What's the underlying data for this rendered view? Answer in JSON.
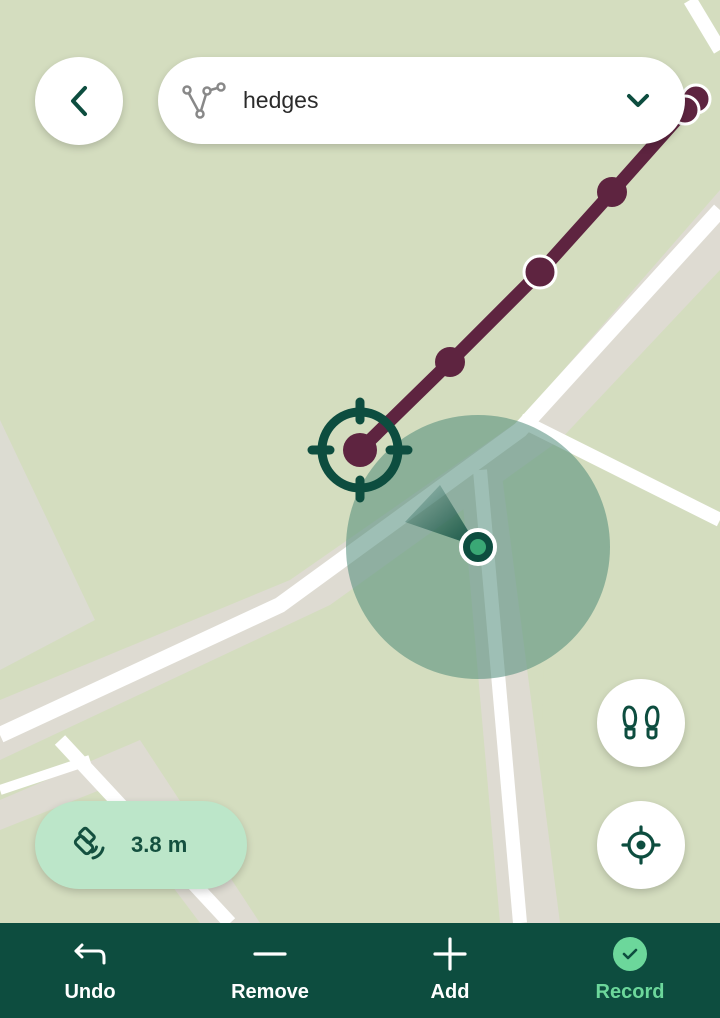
{
  "header": {
    "back_icon": "chevron-left-icon",
    "layer_icon": "polyline-icon",
    "layer_name": "hedges",
    "dropdown_icon": "chevron-down-icon"
  },
  "map": {
    "line_color": "#5e2440",
    "crosshair_color": "#0d4d3f",
    "accuracy_circle_color": "#4f8a78",
    "location_dot_color": "#3aa875"
  },
  "gps": {
    "accuracy_icon": "satellite-icon",
    "accuracy_text": "3.8 m"
  },
  "map_controls": {
    "stream_mode_icon": "footprints-icon",
    "center_location_icon": "crosshair-icon"
  },
  "toolbar": {
    "undo": "Undo",
    "remove": "Remove",
    "add": "Add",
    "record": "Record"
  },
  "colors": {
    "toolbar_bg": "#0d4d3f",
    "accent": "#6cd79b",
    "pill_bg": "#bce6c9"
  }
}
